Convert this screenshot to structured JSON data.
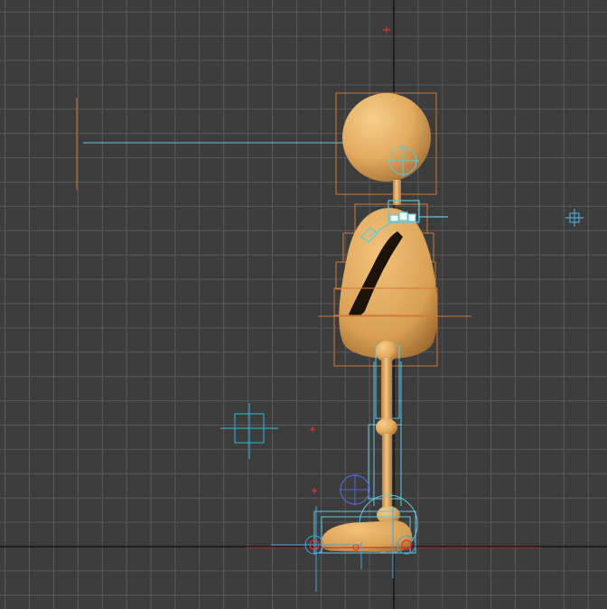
{
  "viewport": {
    "view": "side-viewport",
    "background_color": "#3c3c3c",
    "grid_color": "#5a5a5a",
    "axis_color": "#141414"
  },
  "scene": {
    "character_color": "#e6b266",
    "character_shadow_color": "#a8763a",
    "bounding_box_color": "#d07a3c",
    "bone_color": "#5ec8e0",
    "helper_color": "#4aa4d8",
    "target_color": "#e03030",
    "cyan_helper_color": "#2aa8c0"
  },
  "icons": {
    "point_helper": "crosshair-icon",
    "light_target": "target-icon",
    "small_helper": "small-crosshair-icon"
  }
}
